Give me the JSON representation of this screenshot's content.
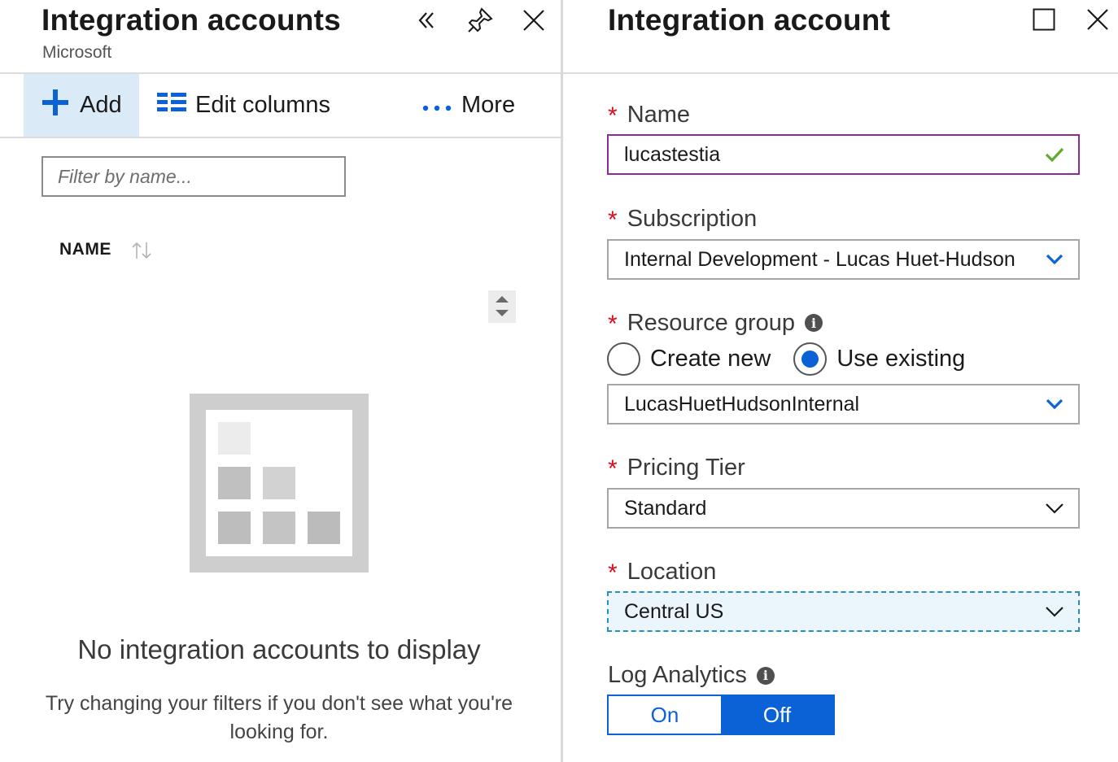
{
  "left_blade": {
    "title": "Integration accounts",
    "subtitle": "Microsoft",
    "toolbar": {
      "add_label": "Add",
      "edit_columns_label": "Edit columns",
      "more_label": "More"
    },
    "filter": {
      "placeholder": "Filter by name..."
    },
    "column_header": "NAME",
    "empty_state": {
      "title": "No integration accounts to display",
      "hint": "Try changing your filters if you don't see what you're looking for."
    }
  },
  "right_blade": {
    "title": "Integration account",
    "fields": {
      "name": {
        "label": "Name",
        "value": "lucastestia"
      },
      "subscription": {
        "label": "Subscription",
        "value": "Internal Development - Lucas Huet-Hudson"
      },
      "resource_group": {
        "label": "Resource group",
        "options": [
          "Create new",
          "Use existing"
        ],
        "selected": "Use existing",
        "value": "LucasHuetHudsonInternal"
      },
      "pricing_tier": {
        "label": "Pricing Tier",
        "value": "Standard"
      },
      "location": {
        "label": "Location",
        "value": "Central US"
      },
      "log_analytics": {
        "label": "Log Analytics",
        "options": [
          "On",
          "Off"
        ],
        "selected": "Off"
      }
    }
  },
  "colors": {
    "accent": "#0b62d6",
    "required": "#e00b1c",
    "valid": "#5cad2d",
    "valid_border": "#8c2a96",
    "toolbar_active": "#dbeaf7"
  },
  "icons": {
    "collapse": "double-chevron-left-icon",
    "pin": "pin-icon",
    "close": "close-icon",
    "maximize": "maximize-icon",
    "add": "plus-icon",
    "columns": "columns-icon",
    "more": "ellipsis-icon",
    "sort": "sort-icon",
    "check": "checkmark-icon",
    "chevron": "chevron-down-icon",
    "info": "info-icon"
  }
}
